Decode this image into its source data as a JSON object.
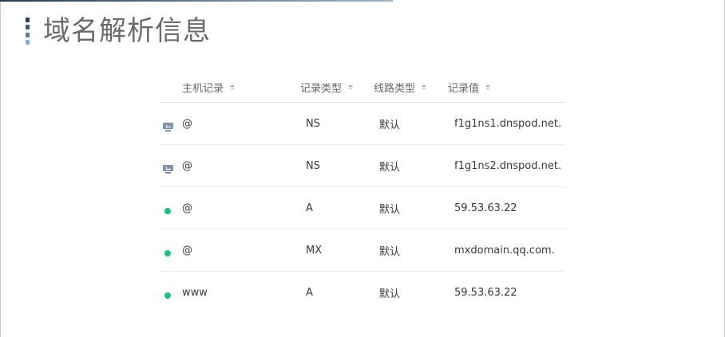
{
  "page": {
    "title": "域名解析信息"
  },
  "table": {
    "headers": [
      "主机记录",
      "记录类型",
      "线路类型",
      "记录值"
    ],
    "rows": [
      {
        "status_icon": "monitor-icon",
        "host": "@",
        "type": "NS",
        "line": "默认",
        "value": "f1g1ns1.dnspod.net."
      },
      {
        "status_icon": "monitor-icon",
        "host": "@",
        "type": "NS",
        "line": "默认",
        "value": "f1g1ns2.dnspod.net."
      },
      {
        "status_icon": "green-dot-icon",
        "host": "@",
        "type": "A",
        "line": "默认",
        "value": "59.53.63.22"
      },
      {
        "status_icon": "green-dot-icon",
        "host": "@",
        "type": "MX",
        "line": "默认",
        "value": "mxdomain.qq.com."
      },
      {
        "status_icon": "green-dot-icon",
        "host": "www",
        "type": "A",
        "line": "默认",
        "value": "59.53.63.22"
      }
    ]
  },
  "colors": {
    "status_dot": "#1fbf7e",
    "monitor_icon": "#7e93ad",
    "title_text": "#6b6b6b"
  }
}
